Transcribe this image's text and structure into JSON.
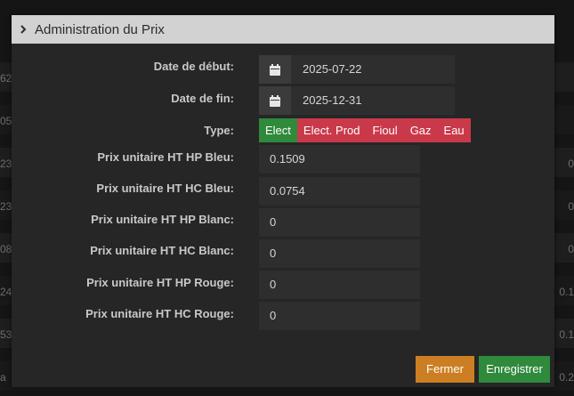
{
  "background": {
    "left_values": [
      "62",
      "05",
      "23",
      "23",
      "08",
      "24",
      "53",
      "a"
    ],
    "right_values": [
      "0",
      "0",
      "0",
      "0.1",
      "0.1",
      "0.2"
    ]
  },
  "modal": {
    "title": "Administration du Prix",
    "fields": {
      "start_date_label": "Date de début:",
      "start_date_value": "2025-07-22",
      "end_date_label": "Date de fin:",
      "end_date_value": "2025-12-31",
      "type_label": "Type:",
      "hp_bleu_label": "Prix unitaire HT HP Bleu:",
      "hp_bleu_value": "0.1509",
      "hc_bleu_label": "Prix unitaire HT HC Bleu:",
      "hc_bleu_value": "0.0754",
      "hp_blanc_label": "Prix unitaire HT HP Blanc:",
      "hp_blanc_value": "0",
      "hc_blanc_label": "Prix unitaire HT HC Blanc:",
      "hc_blanc_value": "0",
      "hp_rouge_label": "Prix unitaire HT HP Rouge:",
      "hp_rouge_value": "0",
      "hc_rouge_label": "Prix unitaire HT HC Rouge:",
      "hc_rouge_value": "0"
    },
    "types": [
      {
        "label": "Elect",
        "active": true
      },
      {
        "label": "Elect. Prod",
        "active": false
      },
      {
        "label": "Fioul",
        "active": false
      },
      {
        "label": "Gaz",
        "active": false
      },
      {
        "label": "Eau",
        "active": false
      }
    ],
    "buttons": {
      "close": "Fermer",
      "save": "Enregistrer"
    }
  },
  "colors": {
    "active_type": "#2f8a3c",
    "inactive_type": "#c9394a",
    "close_button": "#cc7f22",
    "save_button": "#2f8a3c"
  }
}
